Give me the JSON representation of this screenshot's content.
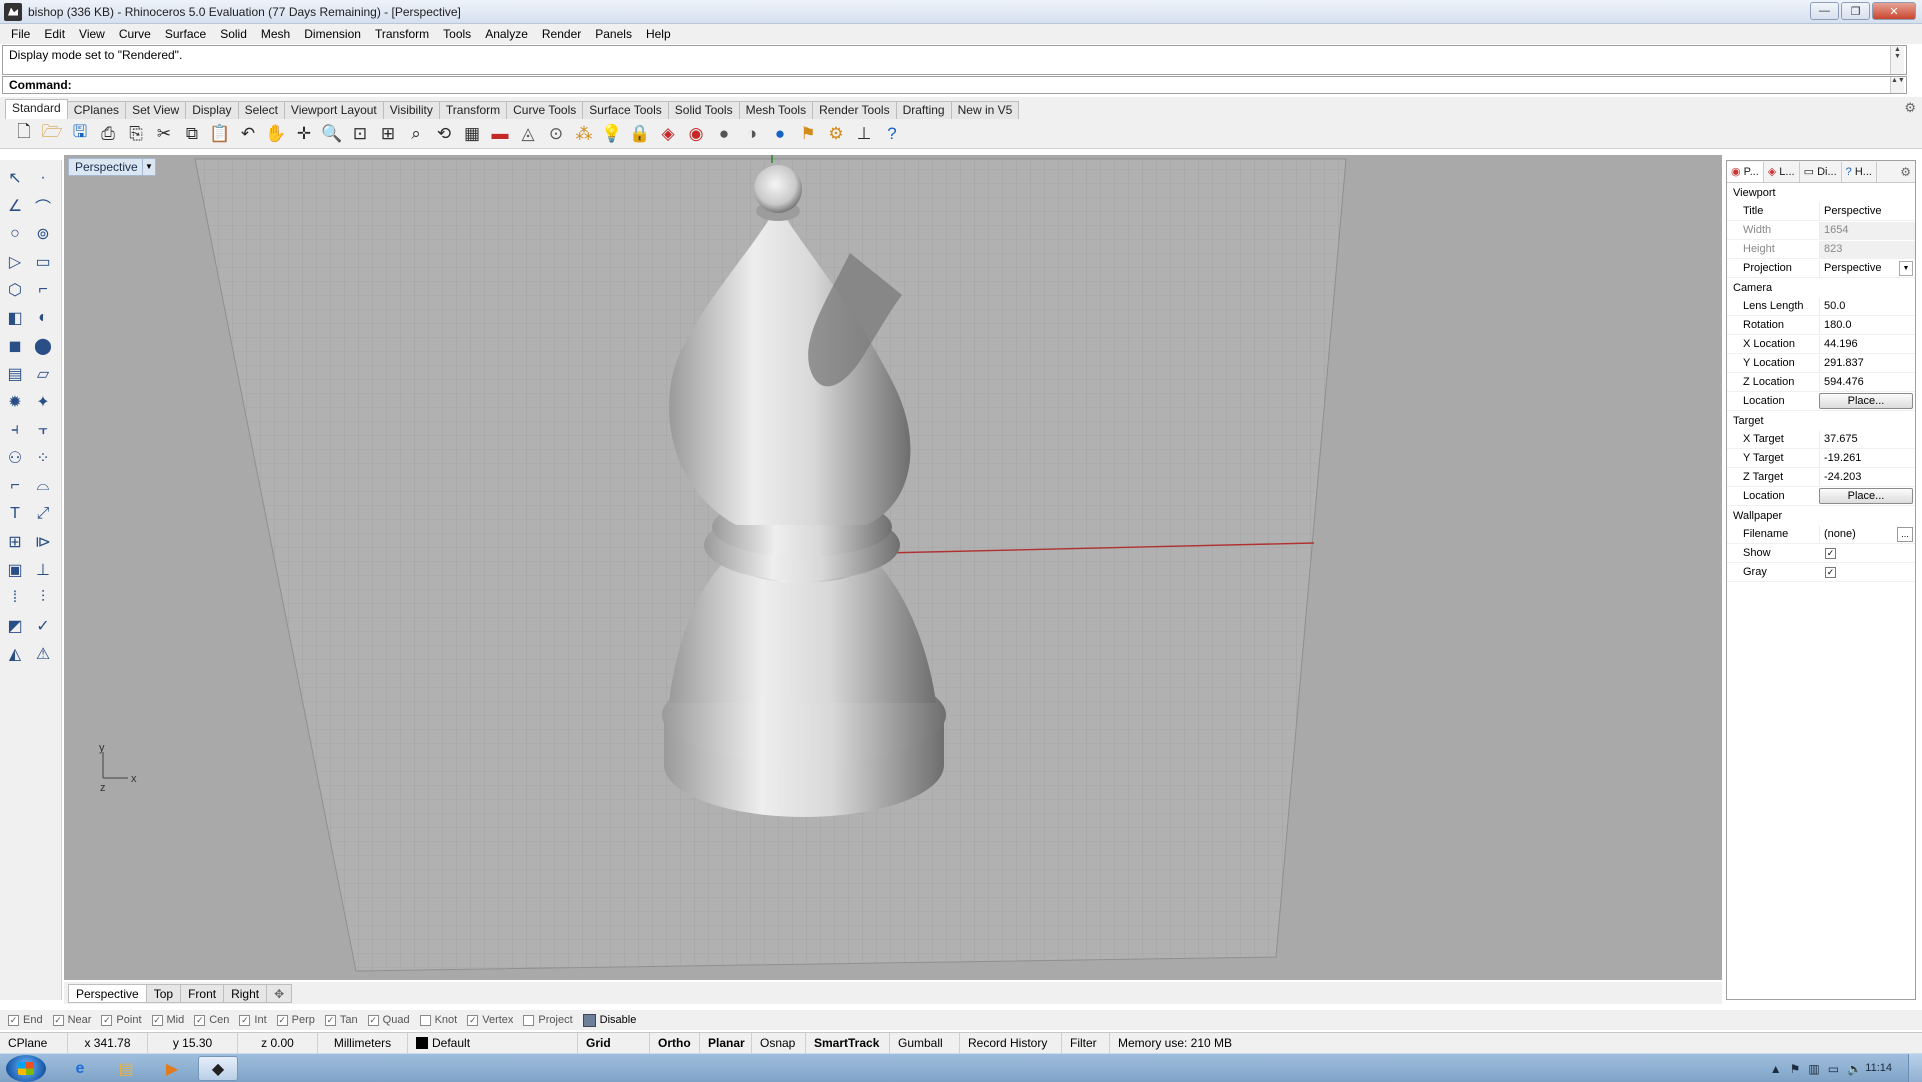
{
  "window": {
    "title": "bishop (336 KB) - Rhinoceros 5.0 Evaluation (77 Days Remaining) - [Perspective]",
    "min": "—",
    "max": "❐",
    "close": "✕"
  },
  "menu": [
    "File",
    "Edit",
    "View",
    "Curve",
    "Surface",
    "Solid",
    "Mesh",
    "Dimension",
    "Transform",
    "Tools",
    "Analyze",
    "Render",
    "Panels",
    "Help"
  ],
  "command": {
    "history": "Display mode set to \"Rendered\".",
    "prompt": "Command:"
  },
  "toolbar_tabs": [
    "Standard",
    "CPlanes",
    "Set View",
    "Display",
    "Select",
    "Viewport Layout",
    "Visibility",
    "Transform",
    "Curve Tools",
    "Surface Tools",
    "Solid Tools",
    "Mesh Tools",
    "Render Tools",
    "Drafting",
    "New in V5"
  ],
  "viewport": {
    "label": "Perspective",
    "axis_y": "y",
    "axis_x": "x",
    "axis_z": "z"
  },
  "view_tabs": [
    "Perspective",
    "Top",
    "Front",
    "Right"
  ],
  "view_tab_add": "✥",
  "osnaps": [
    {
      "label": "End",
      "checked": true
    },
    {
      "label": "Near",
      "checked": true
    },
    {
      "label": "Point",
      "checked": true
    },
    {
      "label": "Mid",
      "checked": true
    },
    {
      "label": "Cen",
      "checked": true
    },
    {
      "label": "Int",
      "checked": true
    },
    {
      "label": "Perp",
      "checked": true
    },
    {
      "label": "Tan",
      "checked": true
    },
    {
      "label": "Quad",
      "checked": true
    },
    {
      "label": "Knot",
      "checked": false
    },
    {
      "label": "Vertex",
      "checked": true
    },
    {
      "label": "Project",
      "checked": false
    }
  ],
  "osnap_disable": "Disable",
  "status": {
    "cplane": "CPlane",
    "x": "x 341.78",
    "y": "y 15.30",
    "z": "z 0.00",
    "units": "Millimeters",
    "layer": "Default",
    "grid_snap": "Grid Snap",
    "ortho": "Ortho",
    "planar": "Planar",
    "osnap": "Osnap",
    "smarttrack": "SmartTrack",
    "gumball": "Gumball",
    "record_history": "Record History",
    "filter": "Filter",
    "memory": "Memory use: 210 MB"
  },
  "panel": {
    "tabs": [
      "P...",
      "L...",
      "Di...",
      "H..."
    ],
    "sections": {
      "viewport": "Viewport",
      "camera": "Camera",
      "target": "Target",
      "wallpaper": "Wallpaper"
    },
    "viewport_rows": [
      {
        "label": "Title",
        "value": "Perspective"
      },
      {
        "label": "Width",
        "value": "1654"
      },
      {
        "label": "Height",
        "value": "823"
      },
      {
        "label": "Projection",
        "value": "Perspective"
      }
    ],
    "camera_rows": [
      {
        "label": "Lens Length",
        "value": "50.0"
      },
      {
        "label": "Rotation",
        "value": "180.0"
      },
      {
        "label": "X Location",
        "value": "44.196"
      },
      {
        "label": "Y Location",
        "value": "291.837"
      },
      {
        "label": "Z Location",
        "value": "594.476"
      },
      {
        "label": "Location",
        "value": "Place..."
      }
    ],
    "target_rows": [
      {
        "label": "X Target",
        "value": "37.675"
      },
      {
        "label": "Y Target",
        "value": "-19.261"
      },
      {
        "label": "Z Target",
        "value": "-24.203"
      },
      {
        "label": "Location",
        "value": "Place..."
      }
    ],
    "wallpaper_rows": [
      {
        "label": "Filename",
        "value": "(none)"
      },
      {
        "label": "Show",
        "checked": true
      },
      {
        "label": "Gray",
        "checked": true
      }
    ]
  },
  "taskbar": {
    "clock": "11:14"
  }
}
